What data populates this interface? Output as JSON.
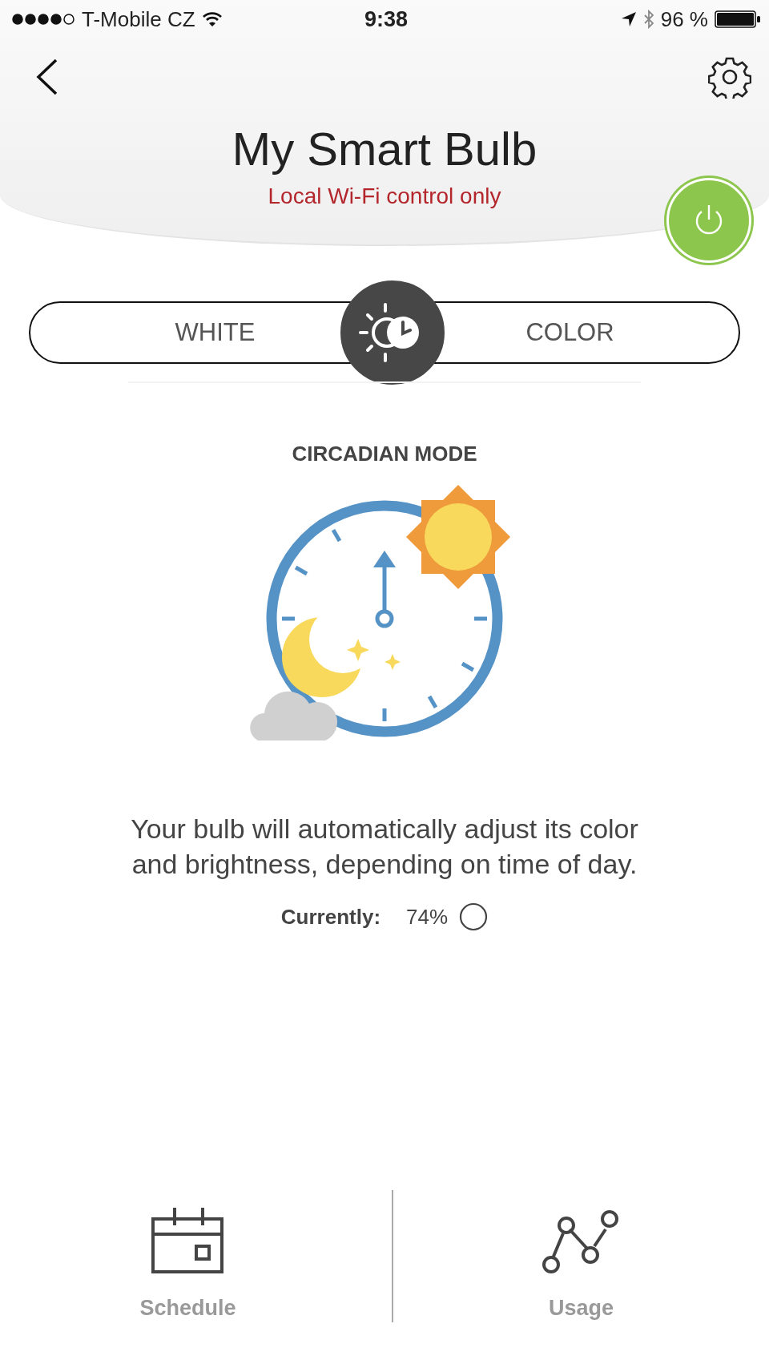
{
  "status_bar": {
    "carrier": "T-Mobile CZ",
    "time": "9:38",
    "battery": "96 %"
  },
  "header": {
    "title": "My Smart Bulb",
    "subtitle": "Local Wi-Fi control only",
    "power_on": true
  },
  "mode_toggle": {
    "options": [
      {
        "label": "WHITE",
        "selected": false
      },
      {
        "label": "COLOR",
        "selected": false
      }
    ],
    "circadian_selected": true
  },
  "mode": {
    "title": "CIRCADIAN MODE",
    "description": "Your bulb will automatically adjust its color and brightness, depending on time of day.",
    "current_label": "Currently:",
    "current_value": "74%"
  },
  "bottom_tabs": [
    {
      "kind": "schedule",
      "label": "Schedule"
    },
    {
      "kind": "usage",
      "label": "Usage"
    }
  ]
}
